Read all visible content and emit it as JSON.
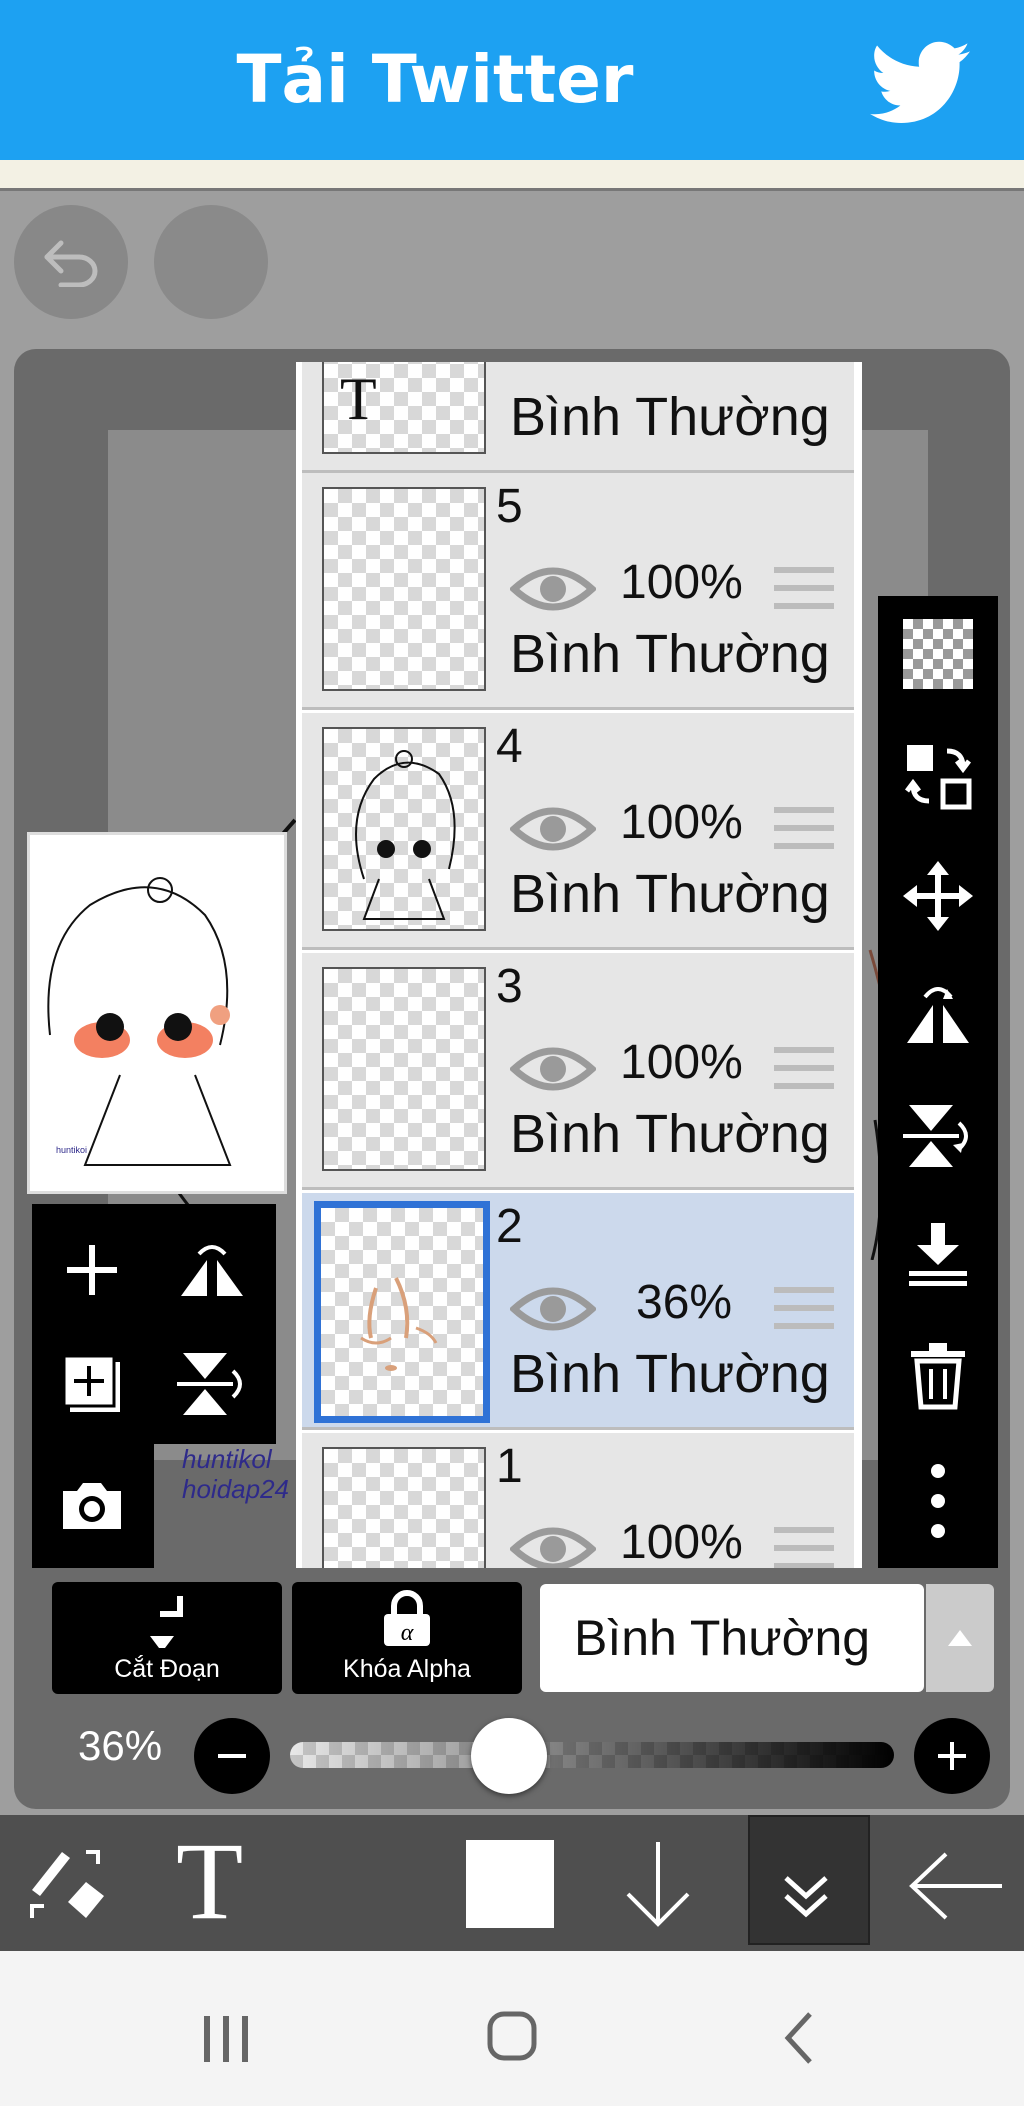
{
  "banner": {
    "title": "Tải Twitter",
    "color": "#1da1f2"
  },
  "layers": [
    {
      "number": "",
      "opacity": "",
      "mode": "Bình Thường",
      "type": "text",
      "thumb_letter": "T",
      "selected": false
    },
    {
      "number": "5",
      "opacity": "100%",
      "mode": "Bình Thường",
      "selected": false
    },
    {
      "number": "4",
      "opacity": "100%",
      "mode": "Bình Thường",
      "selected": false
    },
    {
      "number": "3",
      "opacity": "100%",
      "mode": "Bình Thường",
      "selected": false
    },
    {
      "number": "2",
      "opacity": "36%",
      "mode": "Bình Thường",
      "selected": true
    },
    {
      "number": "1",
      "opacity": "100%",
      "mode": "",
      "selected": false
    }
  ],
  "watermark": {
    "line1": "huntikol",
    "line2": "hoidap24"
  },
  "controls": {
    "clip_label": "Cắt Đoạn",
    "alpha_lock_label": "Khóa Alpha",
    "blend_mode": "Bình Thường",
    "opacity_label": "36%",
    "opacity_value": 0.36
  },
  "icons": {
    "right_toolbar": [
      "transparent-grid-icon",
      "swap-layers-icon",
      "move-icon",
      "flip-horizontal-icon",
      "flip-vertical-icon",
      "merge-down-icon",
      "trash-icon",
      "more-vertical-icon"
    ],
    "left_toolbar": [
      "add-layer-icon",
      "flip-horizontal-icon",
      "add-layer-copy-icon",
      "flip-vertical-icon",
      "camera-icon"
    ],
    "bottom_toolbar": [
      "brush-eraser-swap-icon",
      "text-tool-icon",
      "color-swatch-icon",
      "arrow-down-icon",
      "double-chevron-down-icon",
      "back-arrow-icon"
    ],
    "nav": [
      "recent-apps-icon",
      "home-icon",
      "back-icon"
    ]
  },
  "colors": {
    "selected_layer_bg": "#ccd9ec",
    "selected_layer_border": "#2f72d6"
  }
}
